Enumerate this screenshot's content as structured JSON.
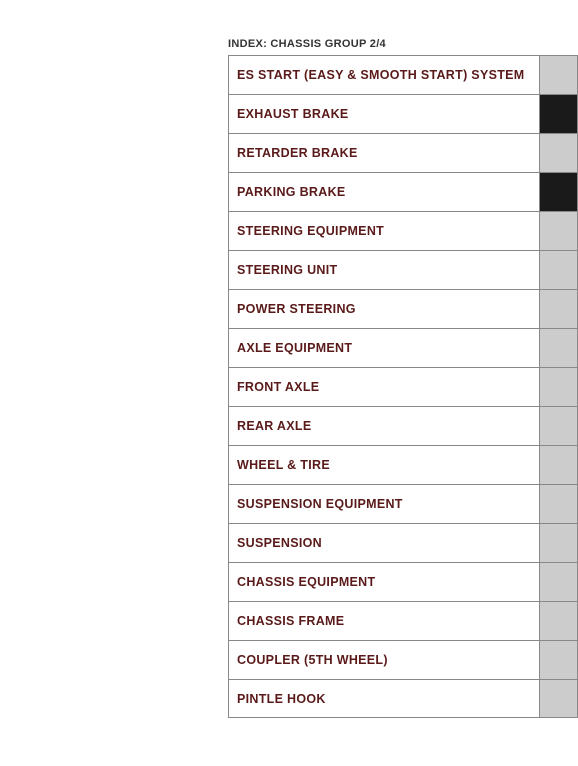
{
  "index": {
    "label": "INDEX: CHASSIS GROUP 2/4"
  },
  "rows": [
    {
      "id": "es-start",
      "label": "ES START (EASY & SMOOTH START) SYSTEM",
      "indicator": "light"
    },
    {
      "id": "exhaust-brake",
      "label": "EXHAUST BRAKE",
      "indicator": "dark"
    },
    {
      "id": "retarder-brake",
      "label": "RETARDER BRAKE",
      "indicator": "light"
    },
    {
      "id": "parking-brake",
      "label": "PARKING BRAKE",
      "indicator": "dark"
    },
    {
      "id": "steering-equipment",
      "label": "STEERING EQUIPMENT",
      "indicator": "light"
    },
    {
      "id": "steering-unit",
      "label": "STEERING UNIT",
      "indicator": "light"
    },
    {
      "id": "power-steering",
      "label": "POWER STEERING",
      "indicator": "light"
    },
    {
      "id": "axle-equipment",
      "label": "AXLE EQUIPMENT",
      "indicator": "light"
    },
    {
      "id": "front-axle",
      "label": "FRONT AXLE",
      "indicator": "light"
    },
    {
      "id": "rear-axle",
      "label": "REAR AXLE",
      "indicator": "light"
    },
    {
      "id": "wheel-tire",
      "label": "WHEEL & TIRE",
      "indicator": "light"
    },
    {
      "id": "suspension-equipment",
      "label": "SUSPENSION EQUIPMENT",
      "indicator": "light"
    },
    {
      "id": "suspension",
      "label": "SUSPENSION",
      "indicator": "light"
    },
    {
      "id": "chassis-equipment",
      "label": "CHASSIS EQUIPMENT",
      "indicator": "light"
    },
    {
      "id": "chassis-frame",
      "label": "CHASSIS FRAME",
      "indicator": "light"
    },
    {
      "id": "coupler-5th-wheel",
      "label": "COUPLER (5TH WHEEL)",
      "indicator": "light"
    },
    {
      "id": "pintle-hook",
      "label": "PINTLE HOOK",
      "indicator": "light"
    }
  ]
}
